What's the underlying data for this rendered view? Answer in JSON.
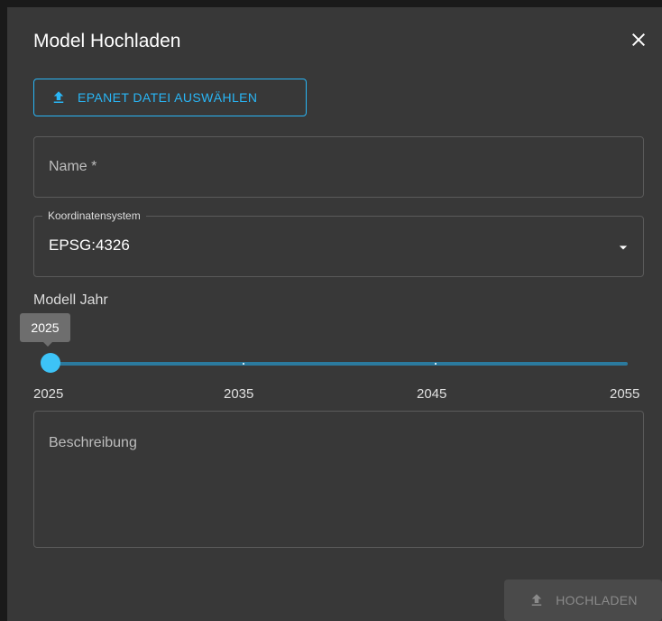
{
  "dialog": {
    "title": "Model Hochladen",
    "close_icon": "close-icon"
  },
  "file_button": {
    "label": "EPANET DATEI AUSWÄHLEN",
    "icon": "upload-icon",
    "color": "#29b6f6"
  },
  "name_field": {
    "placeholder": "Name *",
    "value": ""
  },
  "coordinate_field": {
    "label": "Koordinatensystem",
    "value": "EPSG:4326",
    "icon": "dropdown-caret-icon"
  },
  "year_slider": {
    "label": "Modell Jahr",
    "value": 2025,
    "value_label": "2025",
    "min": 2025,
    "max": 2055,
    "marks": [
      "2025",
      "2035",
      "2045",
      "2055"
    ],
    "color": "#3dc3f7"
  },
  "description_field": {
    "placeholder": "Beschreibung",
    "value": ""
  },
  "submit_button": {
    "label": "HOCHLADEN",
    "icon": "upload-icon",
    "disabled": true
  }
}
